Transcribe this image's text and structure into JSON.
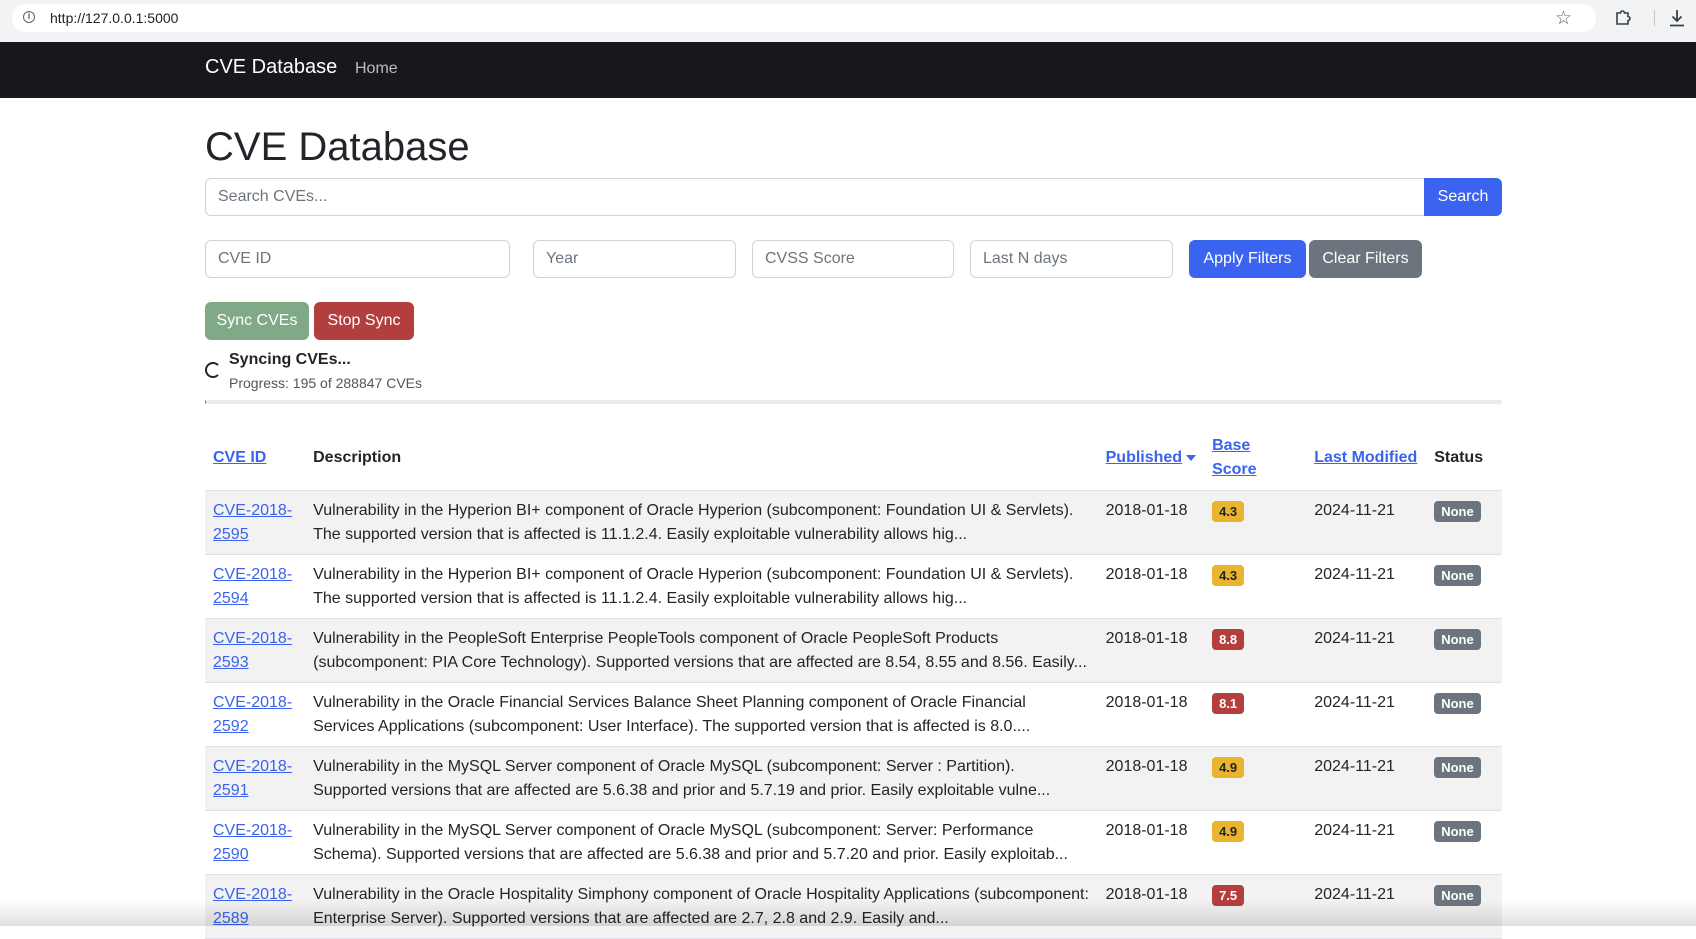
{
  "browser": {
    "url": "http://127.0.0.1:5000",
    "icons": [
      "info-icon",
      "star-icon",
      "extension-icon",
      "download-icon"
    ]
  },
  "navbar": {
    "brand": "CVE Database",
    "home": "Home"
  },
  "page": {
    "title": "CVE Database"
  },
  "search": {
    "placeholder": "Search CVEs...",
    "value": "",
    "button": "Search"
  },
  "filters": {
    "cve_id_placeholder": "CVE ID",
    "year_placeholder": "Year",
    "cvss_placeholder": "CVSS Score",
    "days_placeholder": "Last N days",
    "apply_label": "Apply Filters",
    "clear_label": "Clear Filters"
  },
  "sync": {
    "sync_label": "Sync CVEs",
    "stop_label": "Stop Sync",
    "status_title": "Syncing CVEs...",
    "progress_text": "Progress: 195 of 288847 CVEs",
    "progress_fraction": 0.000675
  },
  "colors": {
    "primary": "#3a63f0",
    "secondary": "#6c757d",
    "success_muted": "#7fa987",
    "danger": "#b23f3e",
    "warning": "#e9b52e",
    "navbar": "#16181b"
  },
  "table": {
    "headers": {
      "cve_id": "CVE ID",
      "description": "Description",
      "published": "Published",
      "base_score": "Base Score",
      "last_modified": "Last Modified",
      "status": "Status"
    },
    "sort": {
      "column": "published",
      "direction": "desc"
    },
    "rows": [
      {
        "id_line1": "CVE-2018-",
        "id_line2": "2595",
        "description": "Vulnerability in the Hyperion BI+ component of Oracle Hyperion (subcomponent: Foundation UI & Servlets). The supported version that is affected is 11.1.2.4. Easily exploitable vulnerability allows hig...",
        "published": "2018-01-18",
        "score": "4.3",
        "severity": "warning",
        "modified": "2024-11-21",
        "status": "None"
      },
      {
        "id_line1": "CVE-2018-",
        "id_line2": "2594",
        "description": "Vulnerability in the Hyperion BI+ component of Oracle Hyperion (subcomponent: Foundation UI & Servlets). The supported version that is affected is 11.1.2.4. Easily exploitable vulnerability allows hig...",
        "published": "2018-01-18",
        "score": "4.3",
        "severity": "warning",
        "modified": "2024-11-21",
        "status": "None"
      },
      {
        "id_line1": "CVE-2018-",
        "id_line2": "2593",
        "description": "Vulnerability in the PeopleSoft Enterprise PeopleTools component of Oracle PeopleSoft Products (subcomponent: PIA Core Technology). Supported versions that are affected are 8.54, 8.55 and 8.56. Easily...",
        "published": "2018-01-18",
        "score": "8.8",
        "severity": "danger",
        "modified": "2024-11-21",
        "status": "None"
      },
      {
        "id_line1": "CVE-2018-",
        "id_line2": "2592",
        "description": "Vulnerability in the Oracle Financial Services Balance Sheet Planning component of Oracle Financial Services Applications (subcomponent: User Interface). The supported version that is affected is 8.0....",
        "published": "2018-01-18",
        "score": "8.1",
        "severity": "danger",
        "modified": "2024-11-21",
        "status": "None"
      },
      {
        "id_line1": "CVE-2018-",
        "id_line2": "2591",
        "description": "Vulnerability in the MySQL Server component of Oracle MySQL (subcomponent: Server : Partition). Supported versions that are affected are 5.6.38 and prior and 5.7.19 and prior. Easily exploitable vulne...",
        "published": "2018-01-18",
        "score": "4.9",
        "severity": "warning",
        "modified": "2024-11-21",
        "status": "None"
      },
      {
        "id_line1": "CVE-2018-",
        "id_line2": "2590",
        "description": "Vulnerability in the MySQL Server component of Oracle MySQL (subcomponent: Server: Performance Schema). Supported versions that are affected are 5.6.38 and prior and 5.7.20 and prior. Easily exploitab...",
        "published": "2018-01-18",
        "score": "4.9",
        "severity": "warning",
        "modified": "2024-11-21",
        "status": "None"
      },
      {
        "id_line1": "CVE-2018-",
        "id_line2": "2589",
        "description": "Vulnerability in the Oracle Hospitality Simphony component of Oracle Hospitality Applications (subcomponent: Enterprise Server). Supported versions that are affected are 2.7, 2.8 and 2.9. Easily and...",
        "published": "2018-01-18",
        "score": "7.5",
        "severity": "danger",
        "modified": "2024-11-21",
        "status": "None"
      }
    ]
  }
}
